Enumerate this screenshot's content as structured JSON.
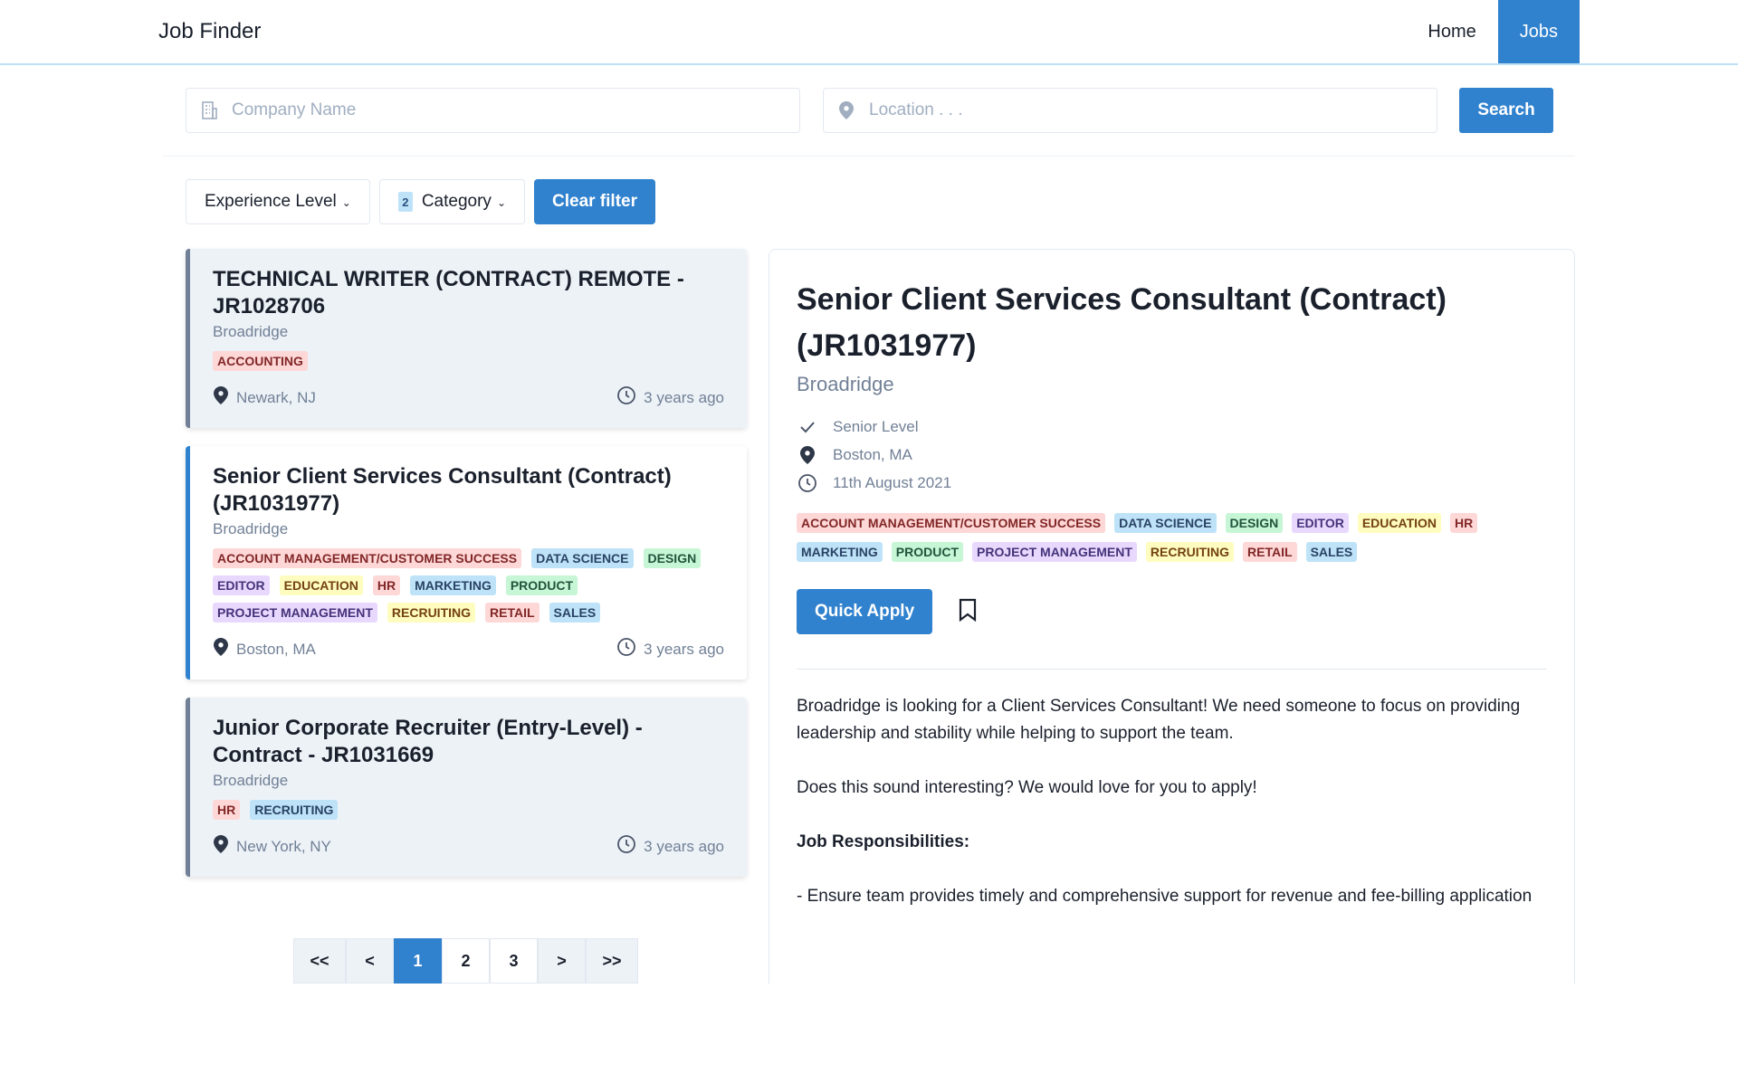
{
  "navbar": {
    "brand": "Job Finder",
    "links": [
      {
        "label": "Home",
        "active": false
      },
      {
        "label": "Jobs",
        "active": true
      }
    ]
  },
  "search": {
    "company_placeholder": "Company Name",
    "location_placeholder": "Location . . .",
    "button_label": "Search"
  },
  "filters": {
    "experience_label": "Experience Level",
    "category_label": "Category",
    "category_count": "2",
    "clear_label": "Clear filter"
  },
  "jobs": [
    {
      "title": "TECHNICAL WRITER (CONTRACT) REMOTE - JR1028706",
      "company": "Broadridge",
      "tags": [
        {
          "label": "ACCOUNTING",
          "color": "red"
        }
      ],
      "location": "Newark, NJ",
      "posted": "3 years ago"
    },
    {
      "title": "Senior Client Services Consultant (Contract) (JR1031977)",
      "company": "Broadridge",
      "tags": [
        {
          "label": "ACCOUNT MANAGEMENT/CUSTOMER SUCCESS",
          "color": "red"
        },
        {
          "label": "DATA SCIENCE",
          "color": "blue"
        },
        {
          "label": "DESIGN",
          "color": "green"
        },
        {
          "label": "EDITOR",
          "color": "purple"
        },
        {
          "label": "EDUCATION",
          "color": "yellow"
        },
        {
          "label": "HR",
          "color": "red"
        },
        {
          "label": "MARKETING",
          "color": "blue"
        },
        {
          "label": "PRODUCT",
          "color": "green"
        },
        {
          "label": "PROJECT MANAGEMENT",
          "color": "purple"
        },
        {
          "label": "RECRUITING",
          "color": "yellow"
        },
        {
          "label": "RETAIL",
          "color": "red"
        },
        {
          "label": "SALES",
          "color": "blue"
        }
      ],
      "location": "Boston, MA",
      "posted": "3 years ago"
    },
    {
      "title": "Junior Corporate Recruiter (Entry-Level) - Contract - JR1031669",
      "company": "Broadridge",
      "tags": [
        {
          "label": "HR",
          "color": "red"
        },
        {
          "label": "RECRUITING",
          "color": "blue"
        }
      ],
      "location": "New York, NY",
      "posted": "3 years ago"
    }
  ],
  "pagination": {
    "first": "<<",
    "prev": "<",
    "pages": [
      "1",
      "2",
      "3"
    ],
    "current": "1",
    "next": ">",
    "last": ">>"
  },
  "detail": {
    "title": "Senior Client Services Consultant (Contract) (JR1031977)",
    "company": "Broadridge",
    "level": "Senior Level",
    "location": "Boston, MA",
    "date": "11th August 2021",
    "tags": [
      {
        "label": "ACCOUNT MANAGEMENT/CUSTOMER SUCCESS",
        "color": "red"
      },
      {
        "label": "DATA SCIENCE",
        "color": "blue"
      },
      {
        "label": "DESIGN",
        "color": "green"
      },
      {
        "label": "EDITOR",
        "color": "purple"
      },
      {
        "label": "EDUCATION",
        "color": "yellow"
      },
      {
        "label": "HR",
        "color": "red"
      },
      {
        "label": "MARKETING",
        "color": "blue"
      },
      {
        "label": "PRODUCT",
        "color": "green"
      },
      {
        "label": "PROJECT MANAGEMENT",
        "color": "purple"
      },
      {
        "label": "RECRUITING",
        "color": "yellow"
      },
      {
        "label": "RETAIL",
        "color": "red"
      },
      {
        "label": "SALES",
        "color": "blue"
      }
    ],
    "apply_label": "Quick Apply",
    "description": {
      "intro": "Broadridge is looking for a Client Services Consultant! We need someone to focus on providing leadership and stability while helping to support the team.",
      "cta": "Does this sound interesting? We would love for you to apply!",
      "responsibilities_heading": "Job Responsibilities:",
      "responsibility_1": "- Ensure team provides timely and comprehensive support for revenue and fee-billing application"
    }
  },
  "colors": {
    "accent": "#3182ce",
    "muted_text": "#718096",
    "card_bg": "#edf2f7"
  }
}
